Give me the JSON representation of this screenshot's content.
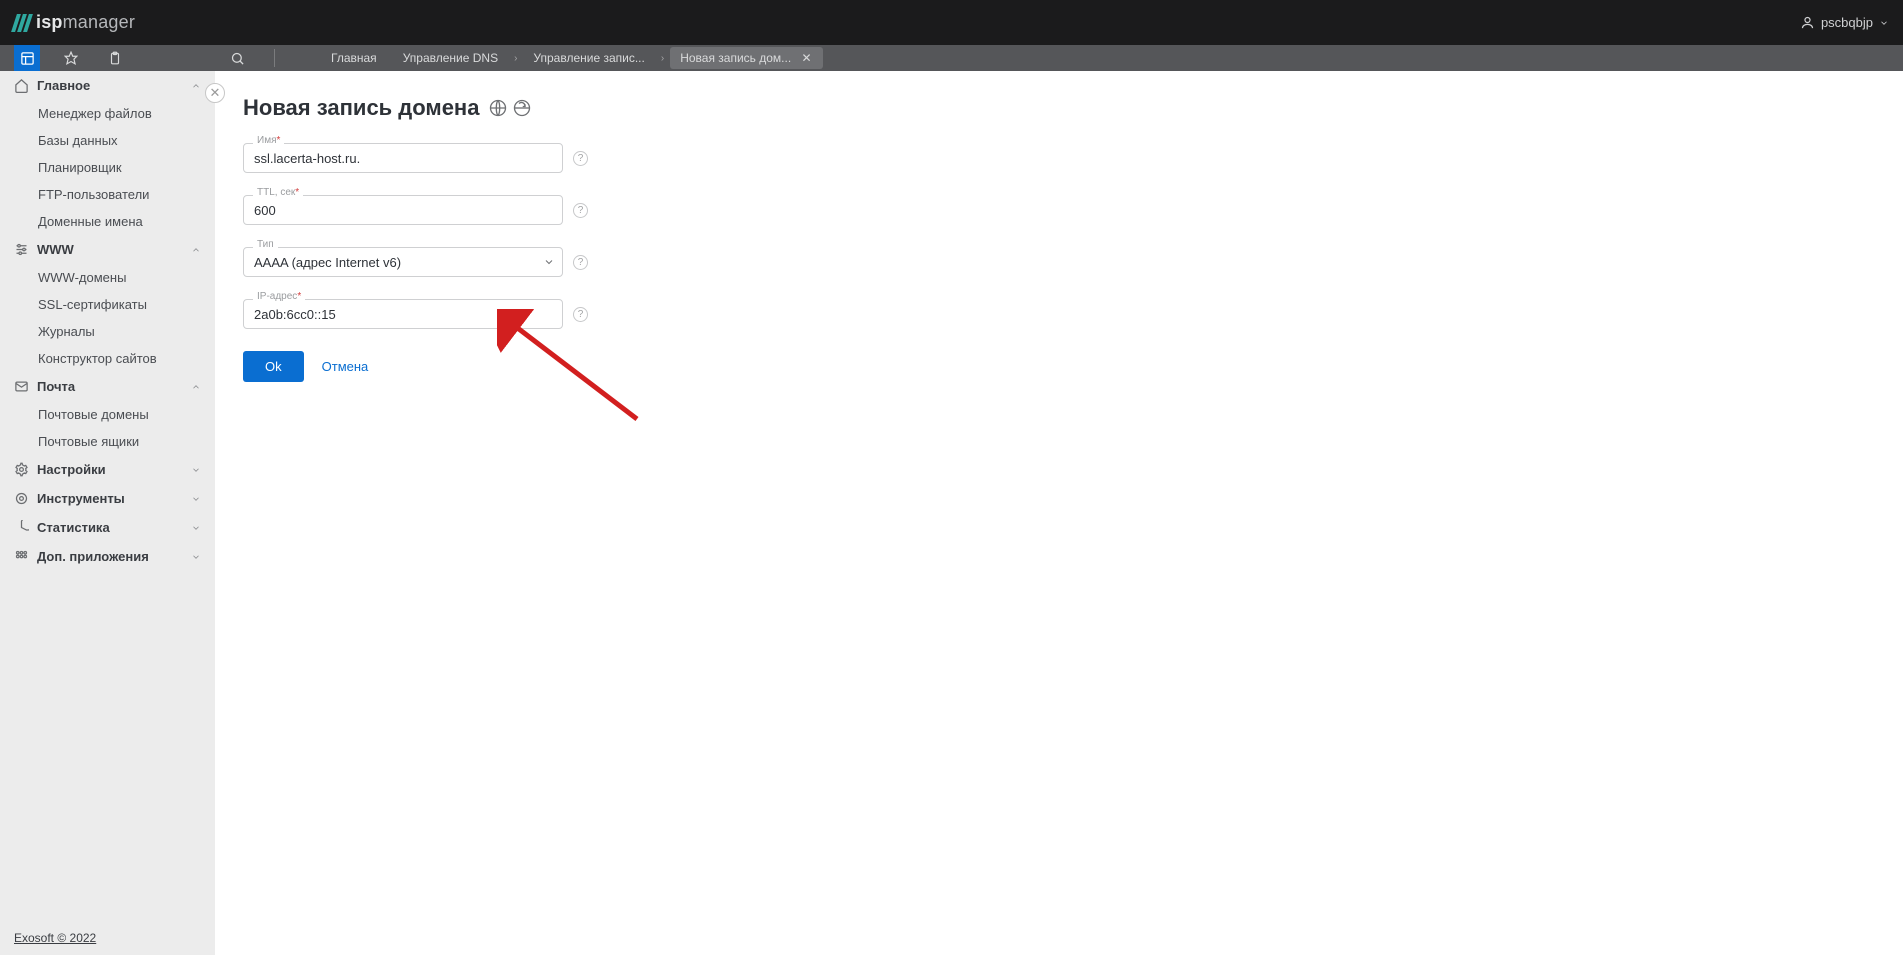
{
  "header": {
    "logo_isp": "isp",
    "logo_manager": "manager",
    "username": "pscbqbjp"
  },
  "breadcrumbs": {
    "items": [
      {
        "label": "Главная"
      },
      {
        "label": "Управление DNS"
      },
      {
        "label": "Управление запис..."
      },
      {
        "label": "Новая запись дом...",
        "active": true,
        "closable": true
      }
    ]
  },
  "sidebar": {
    "groups": [
      {
        "label": "Главное",
        "icon": "home",
        "expanded": true,
        "items": [
          {
            "label": "Менеджер файлов"
          },
          {
            "label": "Базы данных"
          },
          {
            "label": "Планировщик"
          },
          {
            "label": "FTP-пользователи"
          },
          {
            "label": "Доменные имена"
          }
        ]
      },
      {
        "label": "WWW",
        "icon": "sliders",
        "expanded": true,
        "items": [
          {
            "label": "WWW-домены"
          },
          {
            "label": "SSL-сертификаты"
          },
          {
            "label": "Журналы"
          },
          {
            "label": "Конструктор сайтов"
          }
        ]
      },
      {
        "label": "Почта",
        "icon": "mail",
        "expanded": true,
        "items": [
          {
            "label": "Почтовые домены"
          },
          {
            "label": "Почтовые ящики"
          }
        ]
      },
      {
        "label": "Настройки",
        "icon": "gear",
        "expanded": false,
        "items": []
      },
      {
        "label": "Инструменты",
        "icon": "cog",
        "expanded": false,
        "items": []
      },
      {
        "label": "Статистика",
        "icon": "pie",
        "expanded": false,
        "items": []
      },
      {
        "label": "Доп. приложения",
        "icon": "apps",
        "expanded": false,
        "items": []
      }
    ],
    "footer": "Exosoft © 2022"
  },
  "form": {
    "title": "Новая запись домена",
    "fields": {
      "name": {
        "label": "Имя",
        "required": true,
        "value": "ssl.lacerta-host.ru."
      },
      "ttl": {
        "label": "TTL, сек",
        "required": true,
        "value": "600"
      },
      "type": {
        "label": "Тип",
        "required": false,
        "value": "AAAA (адрес Internet v6)"
      },
      "ip": {
        "label": "IP-адрес",
        "required": true,
        "value": "2a0b:6cc0::15"
      }
    },
    "ok_label": "Ok",
    "cancel_label": "Отмена"
  }
}
